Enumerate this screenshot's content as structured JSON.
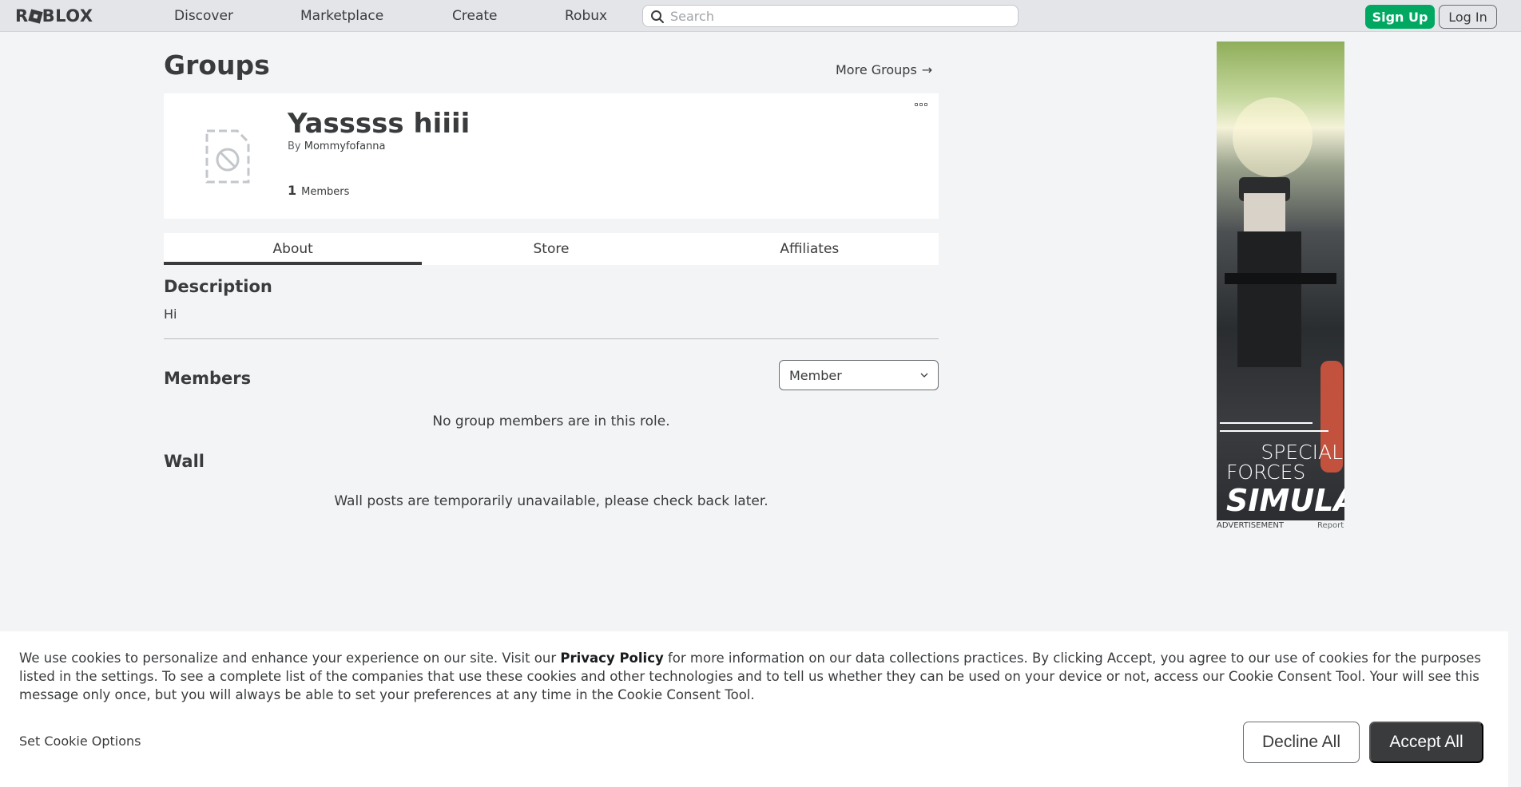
{
  "nav": {
    "logo": "ROBLOX",
    "links": [
      "Discover",
      "Marketplace",
      "Create",
      "Robux"
    ],
    "search_placeholder": "Search",
    "signup_label": "Sign Up",
    "login_label": "Log In"
  },
  "header": {
    "title": "Groups",
    "more_groups": "More Groups",
    "more_groups_arrow": "→"
  },
  "group": {
    "name": "Yasssss hiiii",
    "by_label": "By",
    "owner": "Mommyfofanna",
    "member_count": "1",
    "members_label": "Members"
  },
  "tabs": [
    "About",
    "Store",
    "Affiliates"
  ],
  "active_tab": "About",
  "description": {
    "title": "Description",
    "text": "Hi"
  },
  "members": {
    "title": "Members",
    "role_selected": "Member",
    "empty_message": "No group members are in this role."
  },
  "wall": {
    "title": "Wall",
    "message": "Wall posts are temporarily unavailable, please check back later."
  },
  "ad": {
    "title_line1": "SPECIAL",
    "title_line2": "FORCES",
    "title_line3": "SIMULATOR",
    "label": "ADVERTISEMENT",
    "report": "Report"
  },
  "cookie": {
    "text_before_link": "We use cookies to personalize and enhance your experience on our site. Visit our ",
    "link": "Privacy Policy",
    "text_after_link": " for more information on our data collections practices. By clicking Accept, you agree to our use of cookies for the purposes listed in the settings. To see a complete list of the companies that use these cookies and other technologies and to tell us whether they can be used on your device or not, access our Cookie Consent Tool. Your will see this message only once, but you will always be able to set your preferences at any time in the Cookie Consent Tool.",
    "options_label": "Set Cookie Options",
    "decline_label": "Decline All",
    "accept_label": "Accept All"
  },
  "colors": {
    "signup_green": "#00a862",
    "accept_dark": "#393b3d",
    "background": "#f2f4f5"
  }
}
